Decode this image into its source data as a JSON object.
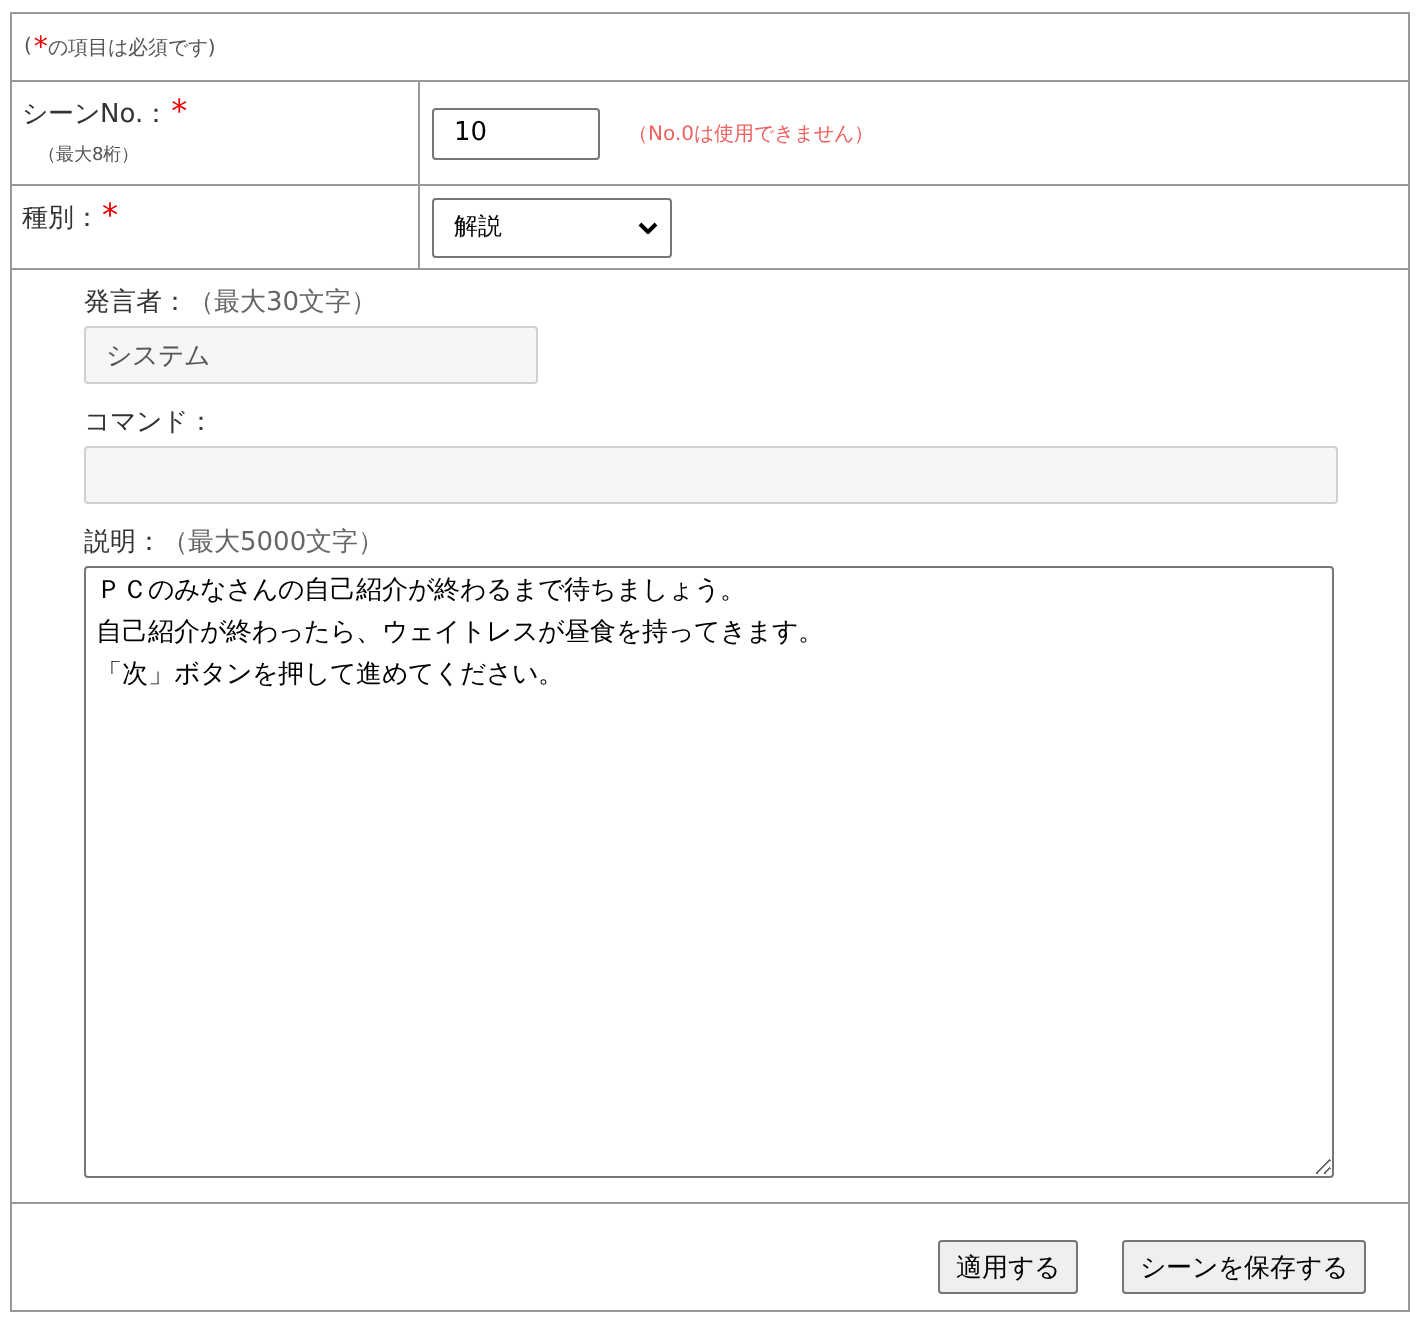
{
  "required_note": {
    "open": "(",
    "mark": "*",
    "text": "の項目は必須です)"
  },
  "rows": [
    {
      "kind": "input",
      "label": "シーンNo.：",
      "required": true,
      "sublabel": "（最大8桁）",
      "value": "10",
      "hint": "（No.0は使用できません）"
    },
    {
      "kind": "select",
      "label": "種別：",
      "required": true,
      "value": "解説"
    }
  ],
  "fields": [
    {
      "kind": "input",
      "label": "発言者：",
      "limit": "（最大30文字）",
      "value": "システム",
      "disabled": true
    },
    {
      "kind": "wide",
      "label": "コマンド：",
      "disabled": true
    },
    {
      "kind": "textarea",
      "label": "説明：",
      "limit": "（最大5000文字）",
      "lines": [
        "ＰＣのみなさんの自己紹介が終わるまで待ちましょう。",
        "自己紹介が終わったら、ウェイトレスが昼食を持ってきます。",
        "「次」ボタンを押して進めてください。"
      ],
      "disabled": false
    }
  ],
  "buttons": [
    "適用する",
    "シーンを保存する"
  ]
}
